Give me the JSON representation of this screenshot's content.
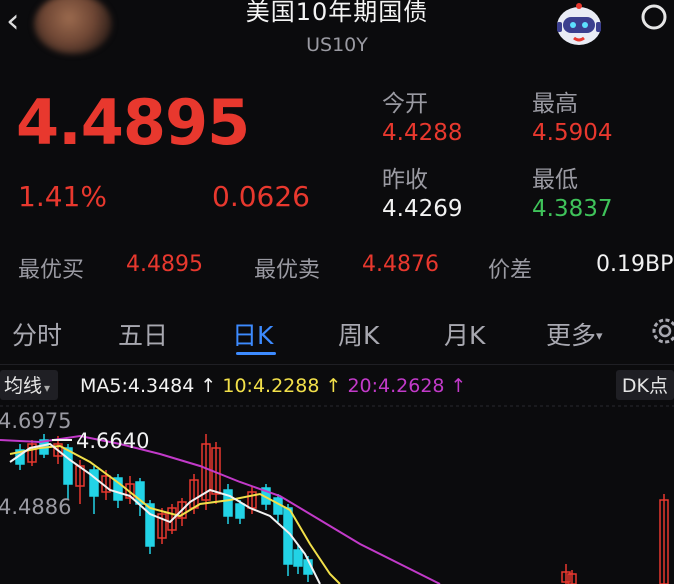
{
  "header": {
    "title": "美国10年期国债",
    "subtitle": "US10Y",
    "back_icon": "chevron-left-icon",
    "assistant_icon": "robot-icon",
    "search_icon": "search-icon"
  },
  "quote": {
    "price": "4.4895",
    "change_pct": "1.41%",
    "change": "0.0626",
    "open_label": "今开",
    "open": "4.4288",
    "high_label": "最高",
    "high": "4.5904",
    "prev_close_label": "昨收",
    "prev_close": "4.4269",
    "low_label": "最低",
    "low": "4.3837"
  },
  "orderbook": {
    "bid_label": "最优买",
    "bid": "4.4895",
    "ask_label": "最优卖",
    "ask": "4.4876",
    "spread_label": "价差",
    "spread": "0.19BP"
  },
  "tabs": [
    "分时",
    "五日",
    "日K",
    "周K",
    "月K",
    "更多"
  ],
  "active_tab": "日K",
  "indicators": {
    "selector": "均线",
    "ma5": "MA5:4.3484",
    "ma10": "10:4.2288",
    "ma20": "20:4.2628",
    "right_button": "DK点"
  },
  "chart_axis": {
    "top_label": "4.6975",
    "mid_label": "4.4886",
    "peak_label": "4.6640"
  },
  "colors": {
    "up": "#e8382e",
    "down": "#22d3e6",
    "green": "#3fc35a",
    "accent": "#3d8bff",
    "ma5": "#f2f2f2",
    "ma10": "#f2e04a",
    "ma20": "#c23ac9"
  }
}
